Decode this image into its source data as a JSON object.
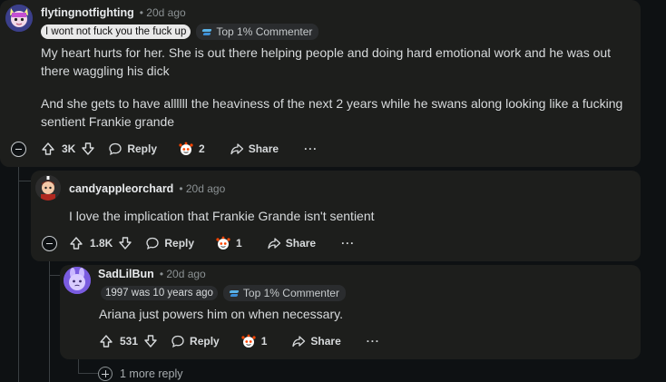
{
  "comments": [
    {
      "username": "flytingnotfighting",
      "time": "• 20d ago",
      "flair": "I wont not fuck you the fuck up",
      "badge": "Top 1% Commenter",
      "paragraphs": [
        "My heart hurts for her. She is out there helping people and doing hard emotional work and he was out there waggling his dick",
        "And she gets to have allllll the heaviness of the next 2 years while he swans along looking like a fucking sentient Frankie grande"
      ],
      "votes": "3K",
      "reply_label": "Reply",
      "award_count": "2",
      "share_label": "Share",
      "more": "···"
    },
    {
      "username": "candyappleorchard",
      "time": "• 20d ago",
      "paragraphs": [
        "I love the implication that Frankie Grande isn't sentient"
      ],
      "votes": "1.8K",
      "reply_label": "Reply",
      "award_count": "1",
      "share_label": "Share",
      "more": "···"
    },
    {
      "username": "SadLilBun",
      "time": "• 20d ago",
      "flair": "1997 was 10 years ago",
      "badge": "Top 1% Commenter",
      "paragraphs": [
        "Ariana just powers him on when necessary."
      ],
      "votes": "531",
      "reply_label": "Reply",
      "award_count": "1",
      "share_label": "Share",
      "more": "···"
    }
  ],
  "more_replies": "1 more reply",
  "colors": {
    "background": "#0e1113",
    "card": "#1d1e1c",
    "award_red": "#ff4500",
    "badge_blue": "#5ab3e8"
  }
}
